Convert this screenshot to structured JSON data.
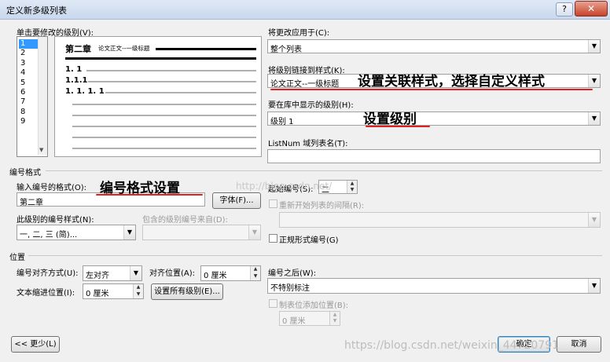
{
  "window": {
    "title": "定义新多级列表",
    "help": "?",
    "close": "✕"
  },
  "level_section": {
    "label": "单击要修改的级别(V):",
    "levels": [
      "1",
      "2",
      "3",
      "4",
      "5",
      "6",
      "7",
      "8",
      "9"
    ]
  },
  "preview": {
    "heading_chapter": "第二章",
    "heading_text": "论文正文--一级标题",
    "row1": "1. 1",
    "row2": "1.1.1",
    "row3": "1. 1. 1. 1"
  },
  "apply_to": {
    "label": "将更改应用于(C):",
    "value": "整个列表"
  },
  "link_style": {
    "label": "将级别链接到样式(K):",
    "value": "论文正文--一级标题"
  },
  "gallery_level": {
    "label": "要在库中显示的级别(H):",
    "value": "级别 1"
  },
  "listnum": {
    "label": "ListNum 域列表名(T):",
    "value": ""
  },
  "number_format": {
    "section": "编号格式",
    "input_label": "输入编号的格式(O):",
    "input_value": "第二章",
    "font_button": "字体(F)...",
    "style_label": "此级别的编号样式(N):",
    "style_value": "一, 二, 三 (简)...",
    "include_label": "包含的级别编号来自(D):",
    "start_label": "起始编号(S):",
    "start_value": "二",
    "restart_label": "重新开始列表的间隔(R):",
    "legal_label": "正规形式编号(G)"
  },
  "position": {
    "section": "位置",
    "align_label": "编号对齐方式(U):",
    "align_value": "左对齐",
    "align_at_label": "对齐位置(A):",
    "align_at_value": "0 厘米",
    "indent_label": "文本缩进位置(I):",
    "indent_value": "0 厘米",
    "set_all_button": "设置所有级别(E)...",
    "after_label": "编号之后(W):",
    "after_value": "不特别标注",
    "tab_label": "制表位添加位置(B):",
    "tab_value": "0 厘米"
  },
  "buttons": {
    "less": "<< 更少(L)",
    "ok": "确定",
    "cancel": "取消"
  },
  "annotations": {
    "a1": "设置关联样式，选择自定义样式",
    "a2": "设置级别",
    "a3": "编号格式设置",
    "line_color": "#e02020"
  },
  "watermarks": {
    "center": "http://blog.csdn.net/",
    "bottom": "https://blog.csdn.net/weixin_44720791"
  }
}
